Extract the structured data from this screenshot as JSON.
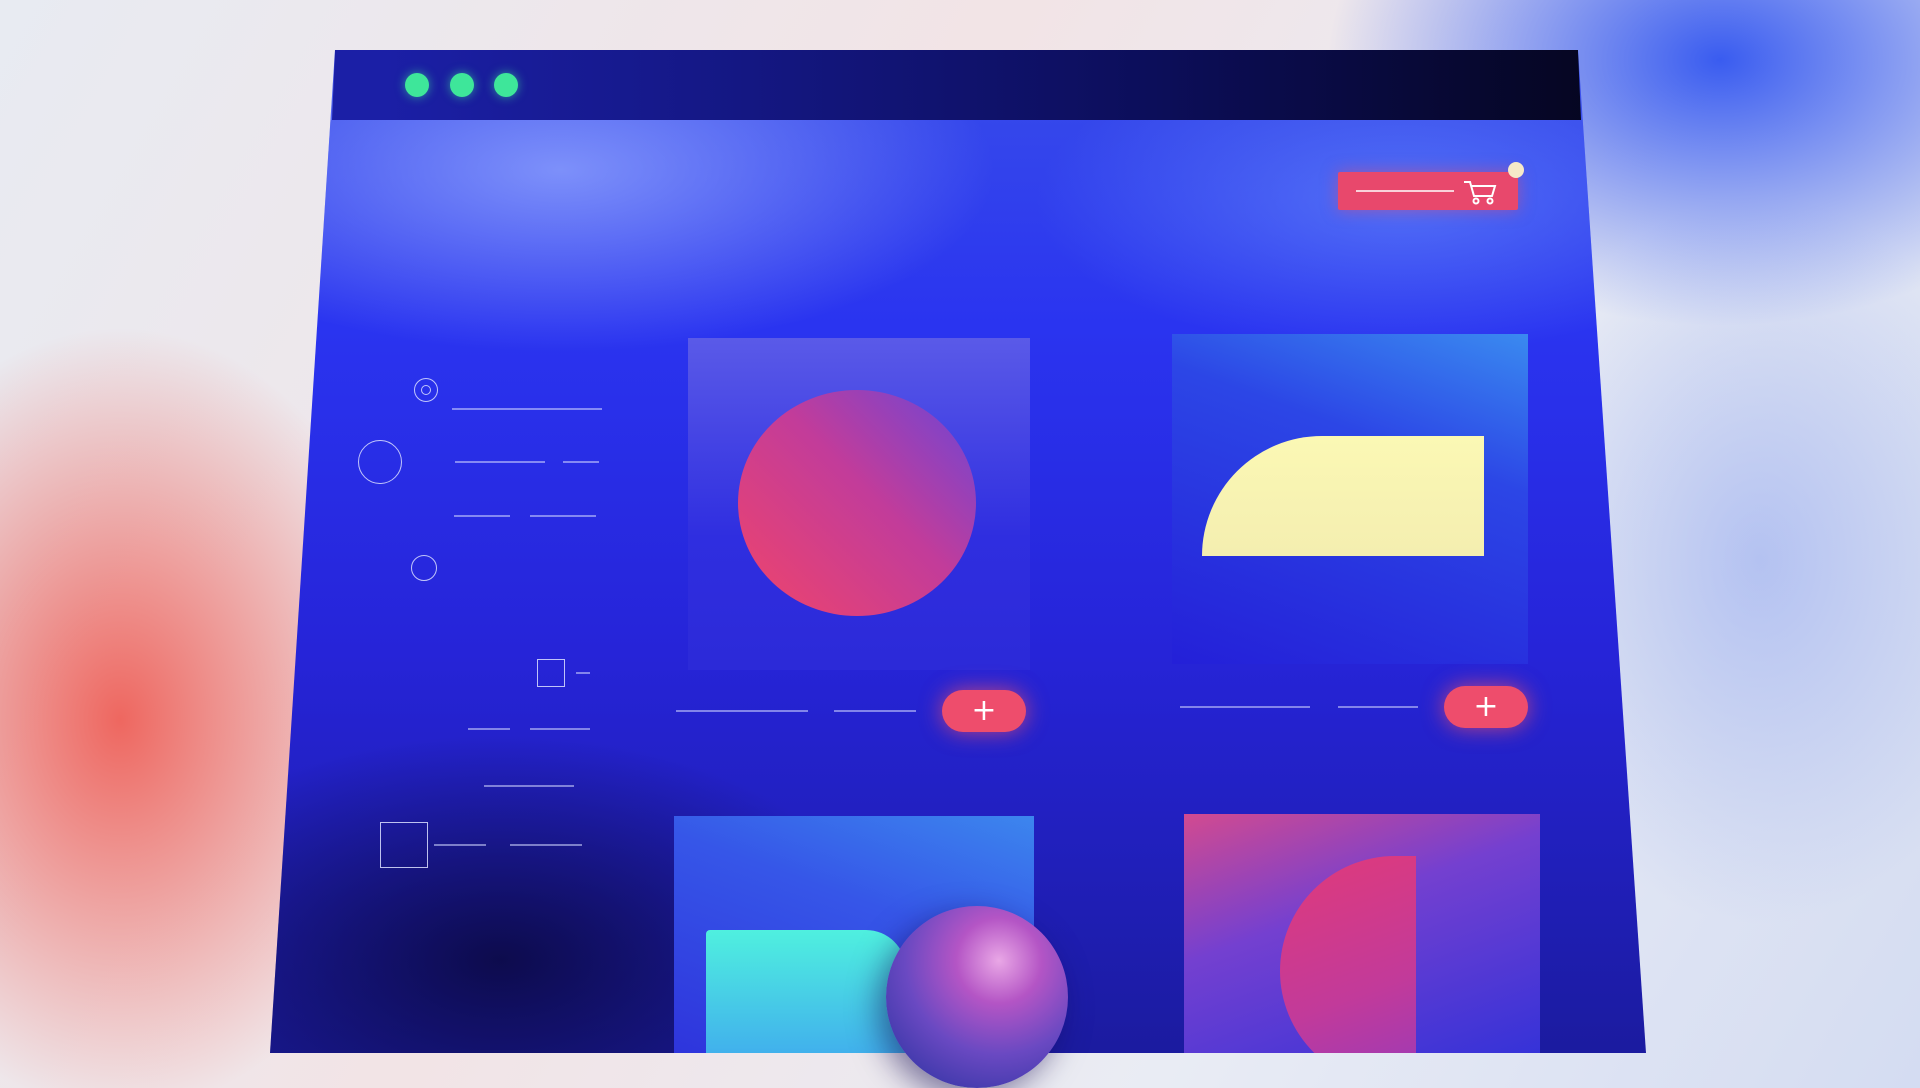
{
  "window": {
    "traffic_lights": [
      {
        "name": "close",
        "color": "#3ee69a"
      },
      {
        "name": "minimize",
        "color": "#3ee69a"
      },
      {
        "name": "maximize",
        "color": "#3ee69a"
      }
    ]
  },
  "header": {
    "cart_button": {
      "icon": "cart-icon",
      "color": "#e8486c",
      "badge_color": "#f6e9c8"
    }
  },
  "products": [
    {
      "shape": "circle",
      "add_label": "+",
      "accent": "#ee4d6c"
    },
    {
      "shape": "rounded-slab",
      "add_label": "+",
      "accent": "#f6f2b0"
    },
    {
      "shape": "teal-block",
      "accent": "#4fe3e0"
    },
    {
      "shape": "half-disc",
      "accent": "#d83880"
    }
  ],
  "colors": {
    "window_top": "#3b52e8",
    "window_bottom": "#1a1a9a",
    "add_button": "#ee4d6c",
    "dots": "#3ee69a"
  }
}
